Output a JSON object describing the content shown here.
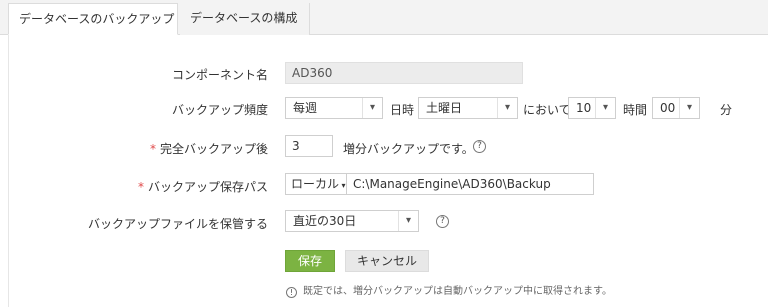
{
  "tabs": [
    {
      "label": "データベースのバックアップ",
      "active": true
    },
    {
      "label": "データベースの構成",
      "active": false
    }
  ],
  "form": {
    "component_name": {
      "label": "コンポーネント名",
      "value": "AD360"
    },
    "frequency": {
      "label": "バックアップ頻度",
      "period": "每週",
      "day_label": "日時",
      "day": "土曜日",
      "at_label": "において",
      "hour": "10",
      "hour_label": "時間",
      "minute": "00",
      "minute_label": "分"
    },
    "full_backup": {
      "required": "*",
      "label": "完全バックアップ後",
      "value": "3",
      "suffix": "増分バックアップです。"
    },
    "path": {
      "required": "*",
      "label": "バックアップ保存パス",
      "location": "ローカル",
      "value": "C:\\ManageEngine\\AD360\\Backup"
    },
    "retention": {
      "label": "バックアップファイルを保管する",
      "value": "直近の30日"
    }
  },
  "buttons": {
    "save": "保存",
    "cancel": "キャンセル"
  },
  "note": "既定では、増分バックアップは自動バックアップ中に取得されます。",
  "icons": {
    "help": "?",
    "info": "!"
  },
  "colors": {
    "save_button": "#7cb342",
    "required": "#e04a4a"
  }
}
